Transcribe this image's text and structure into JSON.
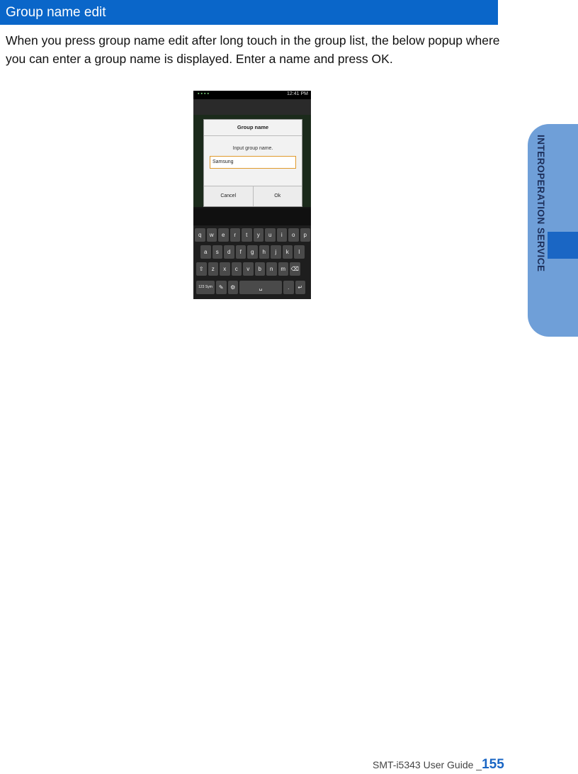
{
  "section": {
    "title": "Group name edit",
    "body": "When you press group name edit after long touch in the group list, the below popup where you can enter a group name is displayed. Enter a name and press OK."
  },
  "side_tab": {
    "label": "INTEROPERATION SERVICE"
  },
  "footer": {
    "guide": "SMT-i5343 User Guide _",
    "page": "155"
  },
  "phone": {
    "time": "12:41 PM",
    "dialog": {
      "title": "Group name",
      "prompt": "Input group name.",
      "input_value": "Samsung",
      "cancel": "Cancel",
      "ok": "Ok"
    },
    "keyboard": {
      "row1": [
        "q",
        "w",
        "e",
        "r",
        "t",
        "y",
        "u",
        "i",
        "o",
        "p"
      ],
      "row2": [
        "a",
        "s",
        "d",
        "f",
        "g",
        "h",
        "j",
        "k",
        "l"
      ],
      "row3": [
        "⇧",
        "z",
        "x",
        "c",
        "v",
        "b",
        "n",
        "m",
        "⌫"
      ],
      "row4": [
        "123 Sym",
        "✎",
        "⚙",
        "␣",
        ".",
        "↵"
      ]
    }
  }
}
